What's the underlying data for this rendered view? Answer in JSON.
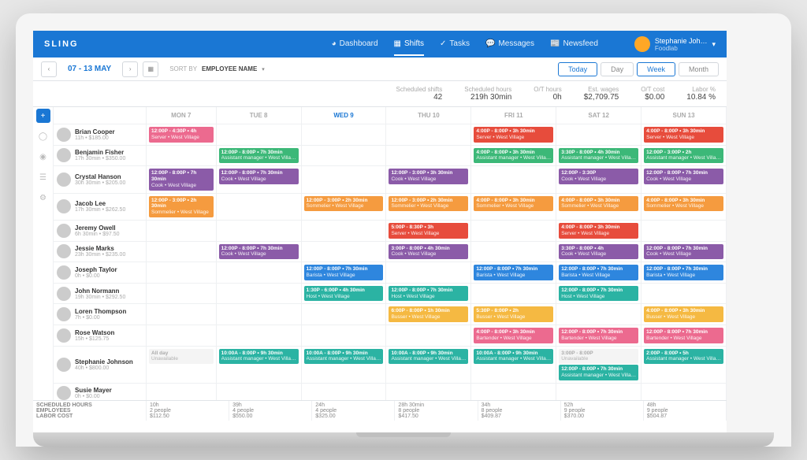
{
  "brand": "SLING",
  "nav": [
    "Dashboard",
    "Shifts",
    "Tasks",
    "Messages",
    "Newsfeed"
  ],
  "nav_active": 1,
  "user": {
    "name": "Stephanie Joh…",
    "org": "Foodlab"
  },
  "date_range": "07 - 13 MAY",
  "sort": {
    "label": "SORT BY",
    "value": "EMPLOYEE NAME"
  },
  "view_buttons": {
    "today": "Today",
    "day": "Day",
    "week": "Week",
    "month": "Month"
  },
  "stats": [
    {
      "lbl": "Scheduled shifts",
      "val": "42"
    },
    {
      "lbl": "Scheduled hours",
      "val": "219h 30min"
    },
    {
      "lbl": "O/T hours",
      "val": "0h"
    },
    {
      "lbl": "Est. wages",
      "val": "$2,709.75"
    },
    {
      "lbl": "O/T cost",
      "val": "$0.00"
    },
    {
      "lbl": "Labor %",
      "val": "10.84 %"
    }
  ],
  "days": [
    "MON 7",
    "TUE 8",
    "WED 9",
    "THU 10",
    "FRI 11",
    "SAT 12",
    "SUN 13"
  ],
  "active_day": 2,
  "colors": {
    "pink": "#ec6a8f",
    "green": "#3cb878",
    "purple": "#8b5ba8",
    "orange": "#f59b3f",
    "red": "#e74c3c",
    "teal": "#2bb3a3",
    "blue": "#2e86de",
    "yellow": "#f5b942"
  },
  "employees": [
    {
      "name": "Brian Cooper",
      "sub": "11h • $185.00",
      "shifts": [
        {
          "day": 0,
          "time": "12:00P - 4:30P • 4h",
          "role": "Server • West Village",
          "c": "pink"
        },
        {
          "day": 4,
          "time": "4:00P - 8:00P • 3h 30min",
          "role": "Server • West Village",
          "c": "red"
        },
        {
          "day": 6,
          "time": "4:00P - 8:00P • 3h 30min",
          "role": "Server • West Village",
          "c": "red"
        }
      ]
    },
    {
      "name": "Benjamin Fisher",
      "sub": "17h 30min • $350.00",
      "shifts": [
        {
          "day": 1,
          "time": "12:00P - 8:00P • 7h 30min",
          "role": "Assistant manager • West Villa…",
          "c": "green"
        },
        {
          "day": 4,
          "time": "4:00P - 8:00P • 3h 30min",
          "role": "Assistant manager • West Villa…",
          "c": "green"
        },
        {
          "day": 5,
          "time": "3:30P - 8:00P • 4h 30min",
          "role": "Assistant manager • West Villa…",
          "c": "green"
        },
        {
          "day": 6,
          "time": "12:00P - 3:00P • 2h",
          "role": "Assistant manager • West Villa…",
          "c": "green"
        }
      ]
    },
    {
      "name": "Crystal Hanson",
      "sub": "30h 30min • $205.00",
      "shifts": [
        {
          "day": 0,
          "time": "12:00P - 8:00P • 7h 30min",
          "role": "Cook • West Village",
          "c": "purple"
        },
        {
          "day": 1,
          "time": "12:00P - 8:00P • 7h 30min",
          "role": "Cook • West Village",
          "c": "purple"
        },
        {
          "day": 3,
          "time": "12:00P - 3:00P • 3h 30min",
          "role": "Cook • West Village",
          "c": "purple"
        },
        {
          "day": 5,
          "time": "12:00P - 3:30P",
          "role": "Cook • West Village",
          "c": "purple"
        },
        {
          "day": 6,
          "time": "12:00P - 8:00P • 7h 30min",
          "role": "Cook • West Village",
          "c": "purple"
        }
      ]
    },
    {
      "name": "Jacob Lee",
      "sub": "17h 30min • $262.50",
      "shifts": [
        {
          "day": 0,
          "time": "12:00P - 3:00P • 2h 30min",
          "role": "Sommelier • West Village",
          "c": "orange"
        },
        {
          "day": 2,
          "time": "12:00P - 3:00P • 2h 30min",
          "role": "Sommelier • West Village",
          "c": "orange"
        },
        {
          "day": 3,
          "time": "12:00P - 3:00P • 2h 30min",
          "role": "Sommelier • West Village",
          "c": "orange"
        },
        {
          "day": 4,
          "time": "4:00P - 8:00P • 3h 30min",
          "role": "Sommelier • West Village",
          "c": "orange"
        },
        {
          "day": 5,
          "time": "4:00P - 8:00P • 3h 30min",
          "role": "Sommelier • West Village",
          "c": "orange"
        },
        {
          "day": 6,
          "time": "4:00P - 8:00P • 3h 30min",
          "role": "Sommelier • West Village",
          "c": "orange"
        }
      ]
    },
    {
      "name": "Jeremy Owell",
      "sub": "6h 30min • $97.50",
      "shifts": [
        {
          "day": 3,
          "time": "5:00P - 8:30P • 3h",
          "role": "Server • West Village",
          "c": "red"
        },
        {
          "day": 5,
          "time": "4:00P - 8:00P • 3h 30min",
          "role": "Server • West Village",
          "c": "red"
        }
      ]
    },
    {
      "name": "Jessie Marks",
      "sub": "23h 30min • $235.00",
      "shifts": [
        {
          "day": 1,
          "time": "12:00P - 8:00P • 7h 30min",
          "role": "Cook • West Village",
          "c": "purple"
        },
        {
          "day": 3,
          "time": "3:00P - 8:00P • 4h 30min",
          "role": "Cook • West Village",
          "c": "purple"
        },
        {
          "day": 5,
          "time": "3:30P - 8:00P • 4h",
          "role": "Cook • West Village",
          "c": "purple"
        },
        {
          "day": 6,
          "time": "12:00P - 8:00P • 7h 30min",
          "role": "Cook • West Village",
          "c": "purple"
        }
      ]
    },
    {
      "name": "Joseph Taylor",
      "sub": "0h • $0.00",
      "shifts": [
        {
          "day": 2,
          "time": "12:00P - 8:00P • 7h 30min",
          "role": "Barista • West Village",
          "c": "blue"
        },
        {
          "day": 4,
          "time": "12:00P - 8:00P • 7h 30min",
          "role": "Barista • West Village",
          "c": "blue"
        },
        {
          "day": 5,
          "time": "12:00P - 8:00P • 7h 30min",
          "role": "Barista • West Village",
          "c": "blue"
        },
        {
          "day": 6,
          "time": "12:00P - 8:00P • 7h 30min",
          "role": "Barista • West Village",
          "c": "blue"
        }
      ]
    },
    {
      "name": "John Normann",
      "sub": "19h 30min • $292.50",
      "shifts": [
        {
          "day": 2,
          "time": "1:30P - 6:00P • 4h 30min",
          "role": "Host • West Village",
          "c": "teal"
        },
        {
          "day": 3,
          "time": "12:00P - 8:00P • 7h 30min",
          "role": "Host • West Village",
          "c": "teal"
        },
        {
          "day": 5,
          "time": "12:00P - 8:00P • 7h 30min",
          "role": "Host • West Village",
          "c": "teal"
        }
      ]
    },
    {
      "name": "Loren Thompson",
      "sub": "7h • $0.00",
      "shifts": [
        {
          "day": 3,
          "time": "6:00P - 8:00P • 1h 30min",
          "role": "Busser • West Village",
          "c": "yellow"
        },
        {
          "day": 4,
          "time": "5:30P - 8:00P • 2h",
          "role": "Busser • West Village",
          "c": "yellow"
        },
        {
          "day": 6,
          "time": "4:00P - 8:00P • 3h 30min",
          "role": "Busser • West Village",
          "c": "yellow"
        }
      ]
    },
    {
      "name": "Rose Watson",
      "sub": "15h • $125.75",
      "shifts": [
        {
          "day": 4,
          "time": "4:00P - 8:00P • 3h 30min",
          "role": "Bartender • West Village",
          "c": "pink"
        },
        {
          "day": 5,
          "time": "12:00P - 8:00P • 7h 30min",
          "role": "Bartender • West Village",
          "c": "pink"
        },
        {
          "day": 6,
          "time": "12:00P - 8:00P • 7h 30min",
          "role": "Bartender • West Village",
          "c": "pink"
        }
      ]
    },
    {
      "name": "Stephanie Johnson",
      "sub": "40h • $800.00",
      "shifts": [
        {
          "day": 0,
          "time": "All day",
          "role": "Unavailable",
          "c": "unavail"
        },
        {
          "day": 1,
          "time": "10:00A - 8:00P • 9h 30min",
          "role": "Assistant manager • West Villa…",
          "c": "teal"
        },
        {
          "day": 2,
          "time": "10:00A - 8:00P • 9h 30min",
          "role": "Assistant manager • West Villa…",
          "c": "teal"
        },
        {
          "day": 3,
          "time": "10:00A - 8:00P • 9h 30min",
          "role": "Assistant manager • West Villa…",
          "c": "teal"
        },
        {
          "day": 4,
          "time": "10:00A - 8:00P • 9h 30min",
          "role": "Assistant manager • West Villa…",
          "c": "teal"
        },
        {
          "day": 5,
          "time": "3:00P - 8:00P",
          "role": "Unavailable",
          "c": "unavail"
        },
        {
          "day": 5,
          "time": "12:00P - 8:00P • 7h 30min",
          "role": "Assistant manager • West Villa…",
          "c": "teal",
          "extra": true
        },
        {
          "day": 6,
          "time": "2:00P - 8:00P • 5h",
          "role": "Assistant manager • West Villa…",
          "c": "teal"
        }
      ]
    },
    {
      "name": "Susie Mayer",
      "sub": "0h • $0.00",
      "shifts": []
    }
  ],
  "footer": {
    "rows": [
      "SCHEDULED HOURS",
      "EMPLOYEES",
      "LABOR COST"
    ],
    "cols": [
      [
        "10h",
        "2 people",
        "$112.50"
      ],
      [
        "39h",
        "4 people",
        "$550.00"
      ],
      [
        "24h",
        "4 people",
        "$325.00"
      ],
      [
        "28h 30min",
        "8 people",
        "$417.50"
      ],
      [
        "34h",
        "8 people",
        "$409.87"
      ],
      [
        "52h",
        "9 people",
        "$370.00"
      ],
      [
        "48h",
        "9 people",
        "$504.87"
      ]
    ]
  }
}
